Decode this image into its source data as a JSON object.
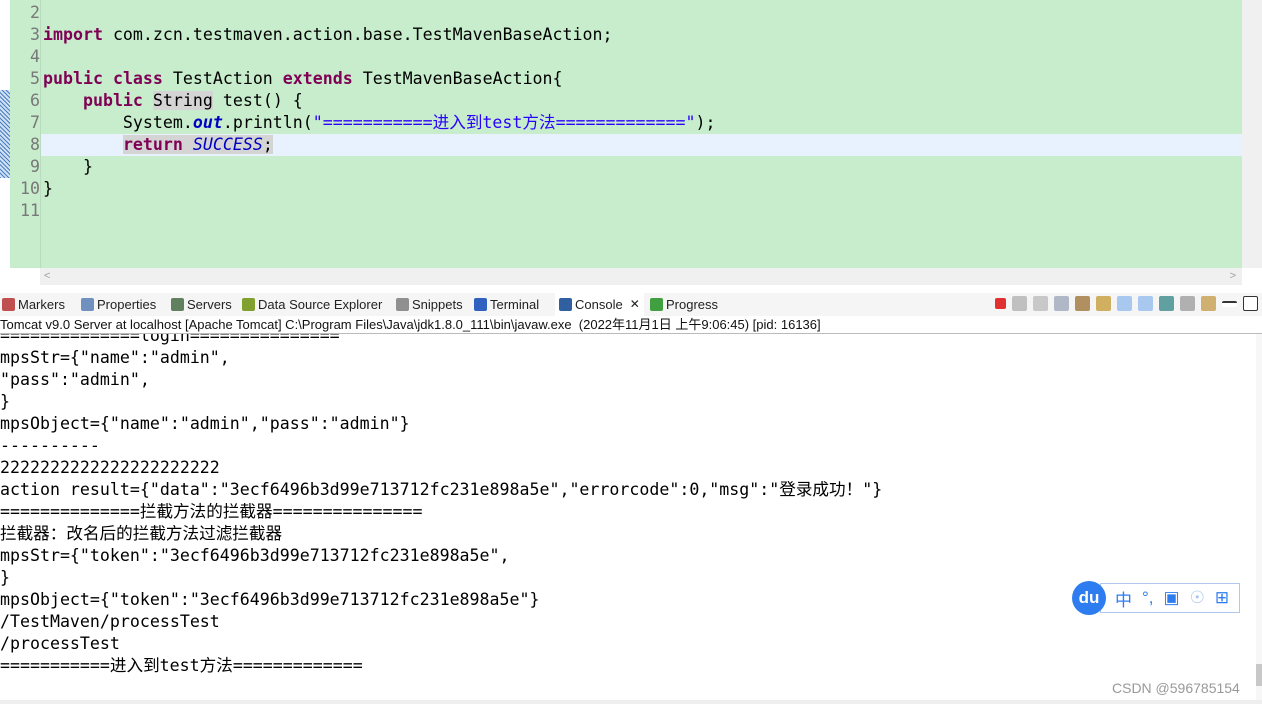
{
  "editor": {
    "line_numbers": [
      "2",
      "3",
      "4",
      "5",
      "6",
      "7",
      "8",
      "9",
      "10",
      "11"
    ],
    "code_lines": [
      [],
      [
        {
          "t": "import",
          "c": "kw"
        },
        {
          "t": " com.zcn.testmaven.action.base.TestMavenBaseAction;"
        }
      ],
      [],
      [
        {
          "t": "public",
          "c": "kw"
        },
        {
          "t": " "
        },
        {
          "t": "class",
          "c": "kw"
        },
        {
          "t": " TestAction "
        },
        {
          "t": "extends",
          "c": "kw"
        },
        {
          "t": " TestMavenBaseAction{"
        }
      ],
      [
        {
          "t": "    "
        },
        {
          "t": "public",
          "c": "kw"
        },
        {
          "t": " "
        },
        {
          "t": "String",
          "c": "hl"
        },
        {
          "t": " test() {"
        }
      ],
      [
        {
          "t": "        System."
        },
        {
          "t": "out",
          "c": "fld"
        },
        {
          "t": ".println("
        },
        {
          "t": "\"===========进入到test方法=============\"",
          "c": "str"
        },
        {
          "t": ");"
        }
      ],
      [
        {
          "t": "        "
        },
        {
          "t": "return",
          "c": "kw hl"
        },
        {
          "t": " ",
          "c": "hl"
        },
        {
          "t": "SUCCESS",
          "c": "cst hl"
        },
        {
          "t": ";",
          "c": "hl"
        }
      ],
      [
        {
          "t": "    }"
        }
      ],
      [
        {
          "t": "}"
        }
      ],
      []
    ],
    "current_line_index": 6
  },
  "panel": {
    "tabs": [
      {
        "label": "Markers",
        "icon": "markers-icon",
        "color": "#c05050"
      },
      {
        "label": "Properties",
        "icon": "properties-icon",
        "color": "#7090c0"
      },
      {
        "label": "Servers",
        "icon": "servers-icon",
        "color": "#608060"
      },
      {
        "label": "Data Source Explorer",
        "icon": "data-source-icon",
        "color": "#80a030"
      },
      {
        "label": "Snippets",
        "icon": "snippets-icon",
        "color": "#909090"
      },
      {
        "label": "Terminal",
        "icon": "terminal-icon",
        "color": "#3060c0"
      },
      {
        "label": "Console",
        "icon": "console-icon",
        "color": "#3060a0",
        "active": true
      },
      {
        "label": "Progress",
        "icon": "progress-icon",
        "color": "#40a040"
      }
    ],
    "close_glyph": "✕",
    "status": "Tomcat v9.0 Server at localhost [Apache Tomcat] C:\\Program Files\\Java\\jdk1.8.0_111\\bin\\javaw.exe  (2022年11月1日 上午9:06:45) [pid: 16136]"
  },
  "console": {
    "lines": [
      "==============login===============",
      "mpsStr={\"name\":\"admin\",",
      "\"pass\":\"admin\",",
      "}",
      "mpsObject={\"name\":\"admin\",\"pass\":\"admin\"}",
      "----------",
      "2222222222222222222222",
      "action result={\"data\":\"3ecf6496b3d99e713712fc231e898a5e\",\"errorcode\":0,\"msg\":\"登录成功！\"}",
      "==============拦截方法的拦截器===============",
      "拦截器：改名后的拦截方法过滤拦截器",
      "mpsStr={\"token\":\"3ecf6496b3d99e713712fc231e898a5e\",",
      "}",
      "mpsObject={\"token\":\"3ecf6496b3d99e713712fc231e898a5e\"}",
      "/TestMaven/processTest",
      "/processTest",
      "===========进入到test方法============="
    ]
  },
  "ime": {
    "logo": "du",
    "mode": "中",
    "punct": "°,"
  },
  "watermark": "CSDN @596785154",
  "colors": {
    "editor_bg": "#c7edcc",
    "keyword": "#7f0055",
    "string": "#2a00ff",
    "constant": "#0000c0",
    "ime_blue": "#2d7df0"
  }
}
